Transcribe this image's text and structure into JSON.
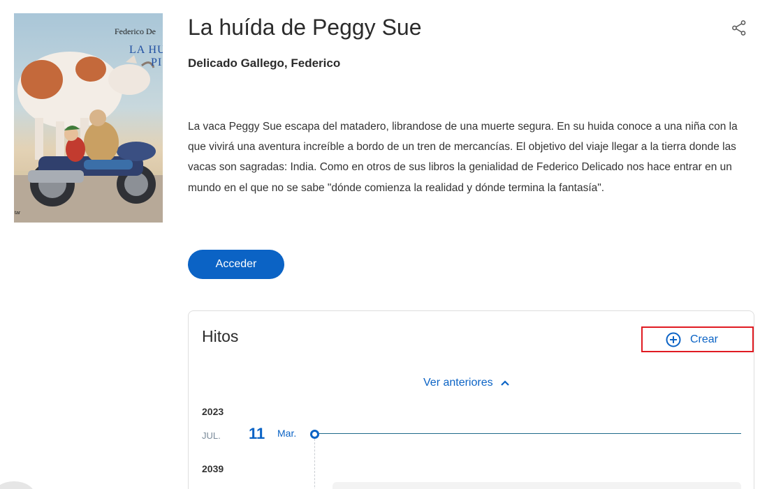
{
  "book": {
    "title": "La huída de Peggy Sue",
    "author": "Delicado Gallego, Federico",
    "description": "La vaca Peggy Sue escapa del matadero, librandose de una muerte segura. En su huida conoce a una niña con la que vivirá una aventura increíble a bordo de un tren de mercancías. El objetivo del viaje llegar a la tierra donde las vacas son sagradas: India. Como en otros de sus libros la genialidad de Federico Delicado nos hace entrar en un mundo en el que no se sabe \"dónde comienza la realidad y dónde termina la fantasía\".",
    "access_label": "Acceder",
    "cover": {
      "author_text": "Federico De",
      "title_line1": "LA HU",
      "title_line2": "PI",
      "small_text": "tar"
    }
  },
  "icons": {
    "share": "share-icon",
    "create": "plus-circle-icon",
    "chevron": "chevron-up-icon"
  },
  "hitos": {
    "title": "Hitos",
    "create_label": "Crear",
    "see_previous_label": "Ver anteriores",
    "entries": [
      {
        "year": "2023",
        "month": "JUL.",
        "day": "11",
        "weekday": "Mar."
      },
      {
        "year": "2039"
      }
    ]
  },
  "colors": {
    "accent": "#0b63c5",
    "highlight_border": "#e01b22",
    "timeline_line": "#1f6a8a"
  }
}
